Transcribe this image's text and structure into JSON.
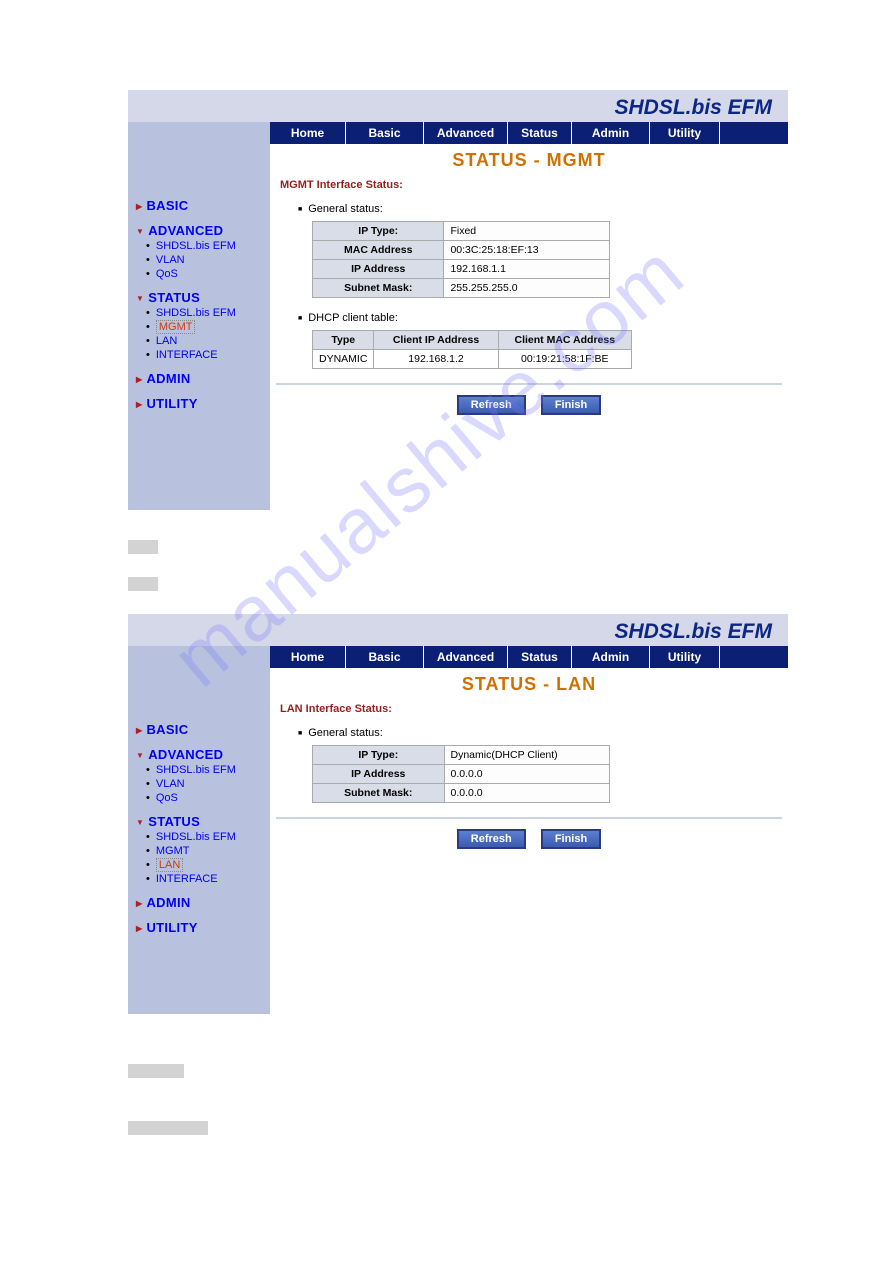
{
  "brand": "SHDSL.bis EFM",
  "nav": {
    "home": "Home",
    "basic": "Basic",
    "advanced": "Advanced",
    "status": "Status",
    "admin": "Admin",
    "utility": "Utility"
  },
  "sidebar": {
    "basic": "BASIC",
    "advanced": {
      "label": "ADVANCED",
      "items": [
        "SHDSL.bis EFM",
        "VLAN",
        "QoS"
      ]
    },
    "status_mgmt": {
      "label": "STATUS",
      "items": [
        "SHDSL.bis EFM",
        "MGMT",
        "LAN",
        "INTERFACE"
      ],
      "active_index": 1
    },
    "status_lan": {
      "label": "STATUS",
      "items": [
        "SHDSL.bis EFM",
        "MGMT",
        "LAN",
        "INTERFACE"
      ],
      "active_index": 2
    },
    "admin": "ADMIN",
    "utility": "UTILITY"
  },
  "mgmt_page": {
    "title": "STATUS - MGMT",
    "subtitle": "MGMT Interface Status:",
    "general_status_label": "General status:",
    "general": {
      "ip_type_label": "IP Type:",
      "ip_type": "Fixed",
      "mac_label": "MAC Address",
      "mac": "00:3C:25:18:EF:13",
      "ip_label": "IP Address",
      "ip": "192.168.1.1",
      "mask_label": "Subnet Mask:",
      "mask": "255.255.255.0"
    },
    "dhcp_label": "DHCP client table:",
    "dhcp_headers": {
      "type": "Type",
      "client_ip": "Client IP Address",
      "client_mac": "Client MAC Address"
    },
    "dhcp_rows": [
      {
        "type": "DYNAMIC",
        "client_ip": "192.168.1.2",
        "client_mac": "00:19:21:58:1F:BE"
      }
    ],
    "buttons": {
      "refresh": "Refresh",
      "finish": "Finish"
    }
  },
  "lan_page": {
    "title": "STATUS - LAN",
    "subtitle": "LAN Interface Status:",
    "general_status_label": "General status:",
    "general": {
      "ip_type_label": "IP Type:",
      "ip_type": "Dynamic(DHCP Client)",
      "ip_label": "IP Address",
      "ip": "0.0.0.0",
      "mask_label": "Subnet Mask:",
      "mask": "0.0.0.0"
    },
    "buttons": {
      "refresh": "Refresh",
      "finish": "Finish"
    }
  },
  "watermark": "manualshive.com"
}
